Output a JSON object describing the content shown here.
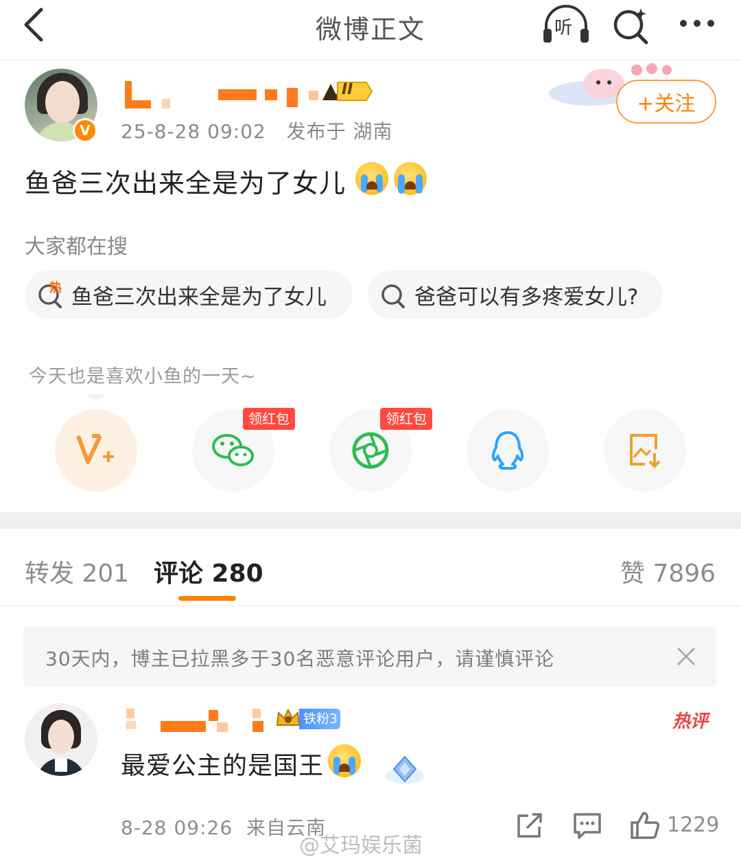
{
  "nav": {
    "title": "微博正文",
    "listen_label": "听",
    "icons": [
      "back-arrow-icon",
      "headphones-icon",
      "search-sparkle-icon",
      "more-dots-icon"
    ]
  },
  "author": {
    "verified_mark": "V",
    "level_label": "II",
    "post_time": "25-8-28 09:02",
    "location_label": "发布于 湖南",
    "follow_label": "+关注"
  },
  "post": {
    "text": "鱼爸三次出来全是为了女儿",
    "emojis": [
      "crying-emoji",
      "sobbing-emoji"
    ]
  },
  "searches": {
    "title": "大家都在搜",
    "hot_tag": "热",
    "items": [
      "鱼爸三次出来全是为了女儿",
      "爸爸可以有多疼爱女儿?"
    ]
  },
  "share": {
    "hint": "今天也是喜欢小鱼的一天~",
    "red_packet_label": "领红包",
    "targets": [
      "v-plus-icon",
      "wechat-icon",
      "moments-icon",
      "qq-icon",
      "save-image-icon"
    ]
  },
  "tabs": {
    "repost": "转发 201",
    "comment": "评论 280",
    "like": "赞 7896"
  },
  "notice": {
    "text": "30天内，博主已拉黑多于30名恶意评论用户，请谨慎评论"
  },
  "comment": {
    "fan_badge": "铁粉3",
    "hot_badge": "热评",
    "text": "最爱公主的是国王",
    "time": "8-28 09:26",
    "location": "来自云南",
    "like_count": "1229"
  },
  "watermark": "@艾玛娱乐菌",
  "colors": {
    "accent": "#ff8200",
    "redact": "#ff7a1a",
    "hot": "#e8453c",
    "divider": "#efefef"
  }
}
